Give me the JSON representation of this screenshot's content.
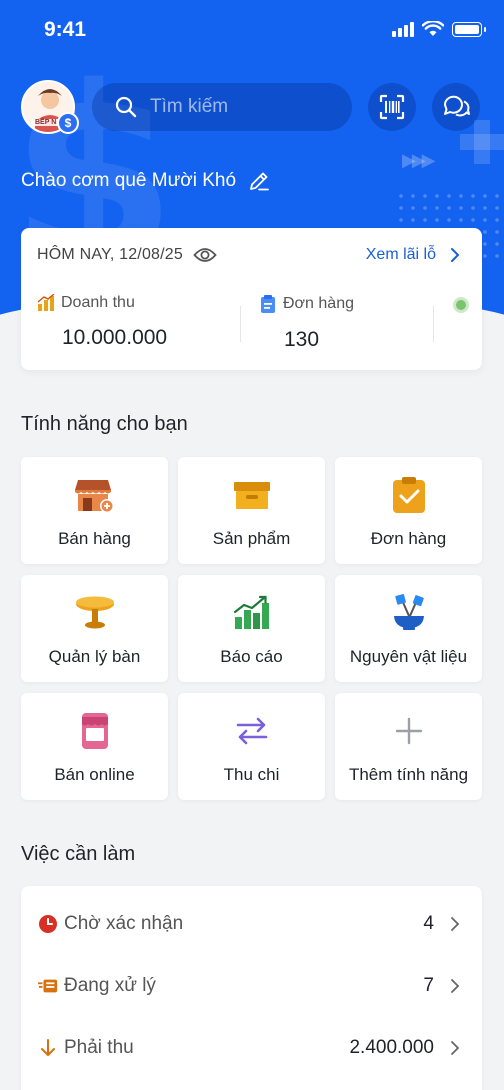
{
  "status_bar": {
    "time": "9:41"
  },
  "header": {
    "avatar": {
      "logo_text": "BẾP N"
    },
    "search": {
      "placeholder": "Tìm kiếm"
    },
    "greeting": "Chào cơm quê Mười Khó"
  },
  "today": {
    "title": "HÔM NAY, 12/08/25",
    "link": "Xem lãi lỗ",
    "metrics": [
      {
        "label": "Doanh thu",
        "value": "10.000.000",
        "icon": "bar-chart-icon"
      },
      {
        "label": "Đơn hàng",
        "value": "130",
        "icon": "clipboard-icon"
      }
    ]
  },
  "features": {
    "title": "Tính năng cho bạn",
    "items": [
      {
        "label": "Bán hàng",
        "icon": "store-icon"
      },
      {
        "label": "Sản phẩm",
        "icon": "box-icon"
      },
      {
        "label": "Đơn hàng",
        "icon": "order-icon"
      },
      {
        "label": "Quản lý bàn",
        "icon": "table-icon"
      },
      {
        "label": "Báo cáo",
        "icon": "report-icon"
      },
      {
        "label": "Nguyên vật liệu",
        "icon": "ingredients-icon"
      },
      {
        "label": "Bán online",
        "icon": "online-store-icon"
      },
      {
        "label": "Thu chi",
        "icon": "transfer-icon"
      },
      {
        "label": "Thêm tính năng",
        "icon": "plus-icon"
      }
    ]
  },
  "todo": {
    "title": "Việc cần làm",
    "items": [
      {
        "label": "Chờ xác nhận",
        "value": "4",
        "icon": "clock-icon"
      },
      {
        "label": "Đang xử lý",
        "value": "7",
        "icon": "processing-icon"
      },
      {
        "label": "Phải thu",
        "value": "2.400.000",
        "icon": "arrow-down-icon"
      }
    ]
  },
  "colors": {
    "primary": "#1463f0",
    "link": "#1a5fd8",
    "orange": "#e8a317",
    "green": "#34a853",
    "red": "#d93025",
    "purple": "#7b61d9"
  }
}
